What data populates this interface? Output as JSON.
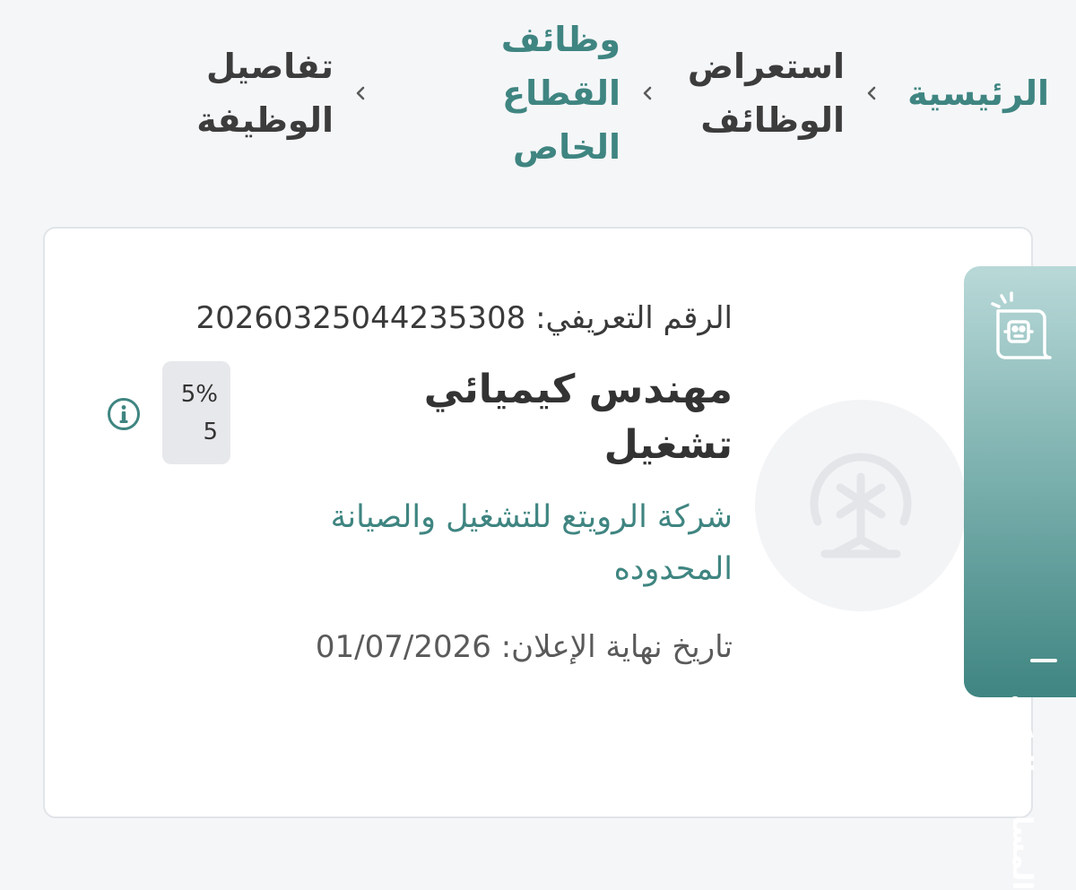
{
  "breadcrumb": {
    "items": [
      {
        "label": "الرئيسية"
      },
      {
        "label": "استعراض\nالوظائف"
      },
      {
        "label": "وظائف القطاع\nالخاص"
      },
      {
        "label": "تفاصيل\nالوظيفة"
      }
    ]
  },
  "job": {
    "ref_label": "الرقم التعريفي:",
    "ref_number": "20260325044235308",
    "title": "مهندس كيميائي\nتشغيل",
    "company": "شركة الرويتع للتشغيل والصيانة المحدوده",
    "end_date_label": "تاريخ نهاية الإعلان:",
    "end_date": "01/07/2026",
    "badge_percent": "5%",
    "badge_count": "5"
  },
  "assistant": {
    "label": "المساعد الذكي"
  },
  "icons": {
    "separator": "chevron-left-icon",
    "info": "info-icon",
    "assistant": "robot-icon",
    "company_logo": "company-logo-icon"
  },
  "colors": {
    "accent": "#3f8581",
    "text": "#3c3c3c",
    "background": "#f5f6f8",
    "card": "#ffffff",
    "badge": "#e7e8ec"
  }
}
